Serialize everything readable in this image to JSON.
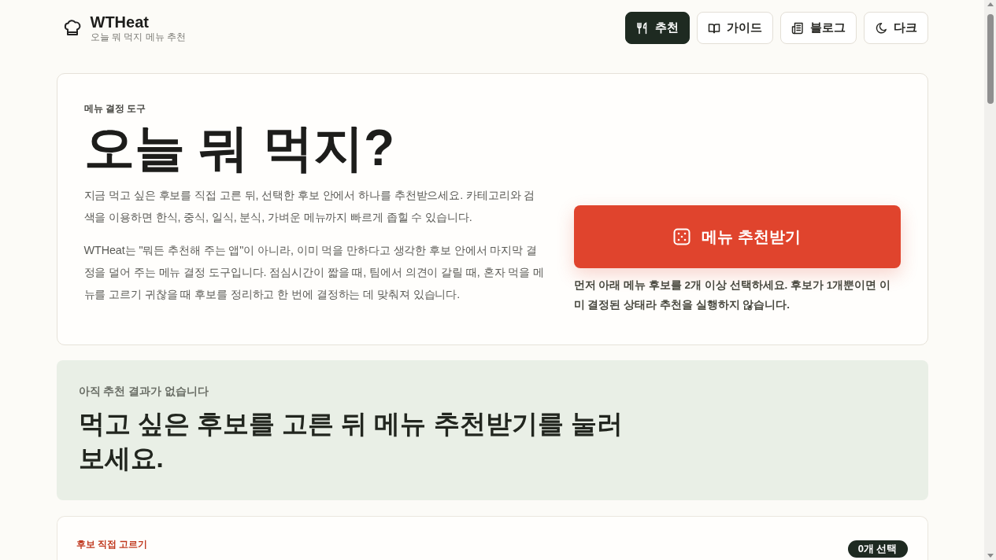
{
  "header": {
    "logo": {
      "title": "WTHeat",
      "subtitle": "오늘 뭐 먹지 메뉴 추천"
    },
    "nav": [
      {
        "label": "추천",
        "selected": true
      },
      {
        "label": "가이드",
        "selected": false
      },
      {
        "label": "블로그",
        "selected": false
      },
      {
        "label": "다크",
        "selected": false
      }
    ]
  },
  "hero": {
    "eyebrow": "메뉴 결정 도구",
    "title": "오늘 뭐 먹지?",
    "paragraphs": [
      "지금 먹고 싶은 후보를 직접 고른 뒤, 선택한 후보 안에서 하나를 추천받으세요. 카테고리와 검색을 이용하면 한식, 중식, 일식, 분식, 가벼운 메뉴까지 빠르게 좁힐 수 있습니다.",
      "WTHeat는 \"뭐든 추천해 주는 앱\"이 아니라, 이미 먹을 만하다고 생각한 후보 안에서 마지막 결정을 덜어 주는 메뉴 결정 도구입니다. 점심시간이 짧을 때, 팀에서 의견이 갈릴 때, 혼자 먹을 메뉴를 고르기 귀찮을 때 후보를 정리하고 한 번에 결정하는 데 맞춰져 있습니다."
    ],
    "cta": {
      "label": "메뉴 추천받기"
    },
    "note": "먼저 아래 메뉴 후보를 2개 이상 선택하세요. 후보가 1개뿐이면 이미 결정된 상태라 추천을 실행하지 않습니다."
  },
  "result": {
    "status": "아직 추천 결과가 없습니다",
    "message": "먹고 싶은 후보를 고른 뒤 메뉴 추천받기를 눌러 보세요."
  },
  "picker": {
    "eyebrow": "후보 직접 고르기",
    "count": "0개 선택"
  }
}
